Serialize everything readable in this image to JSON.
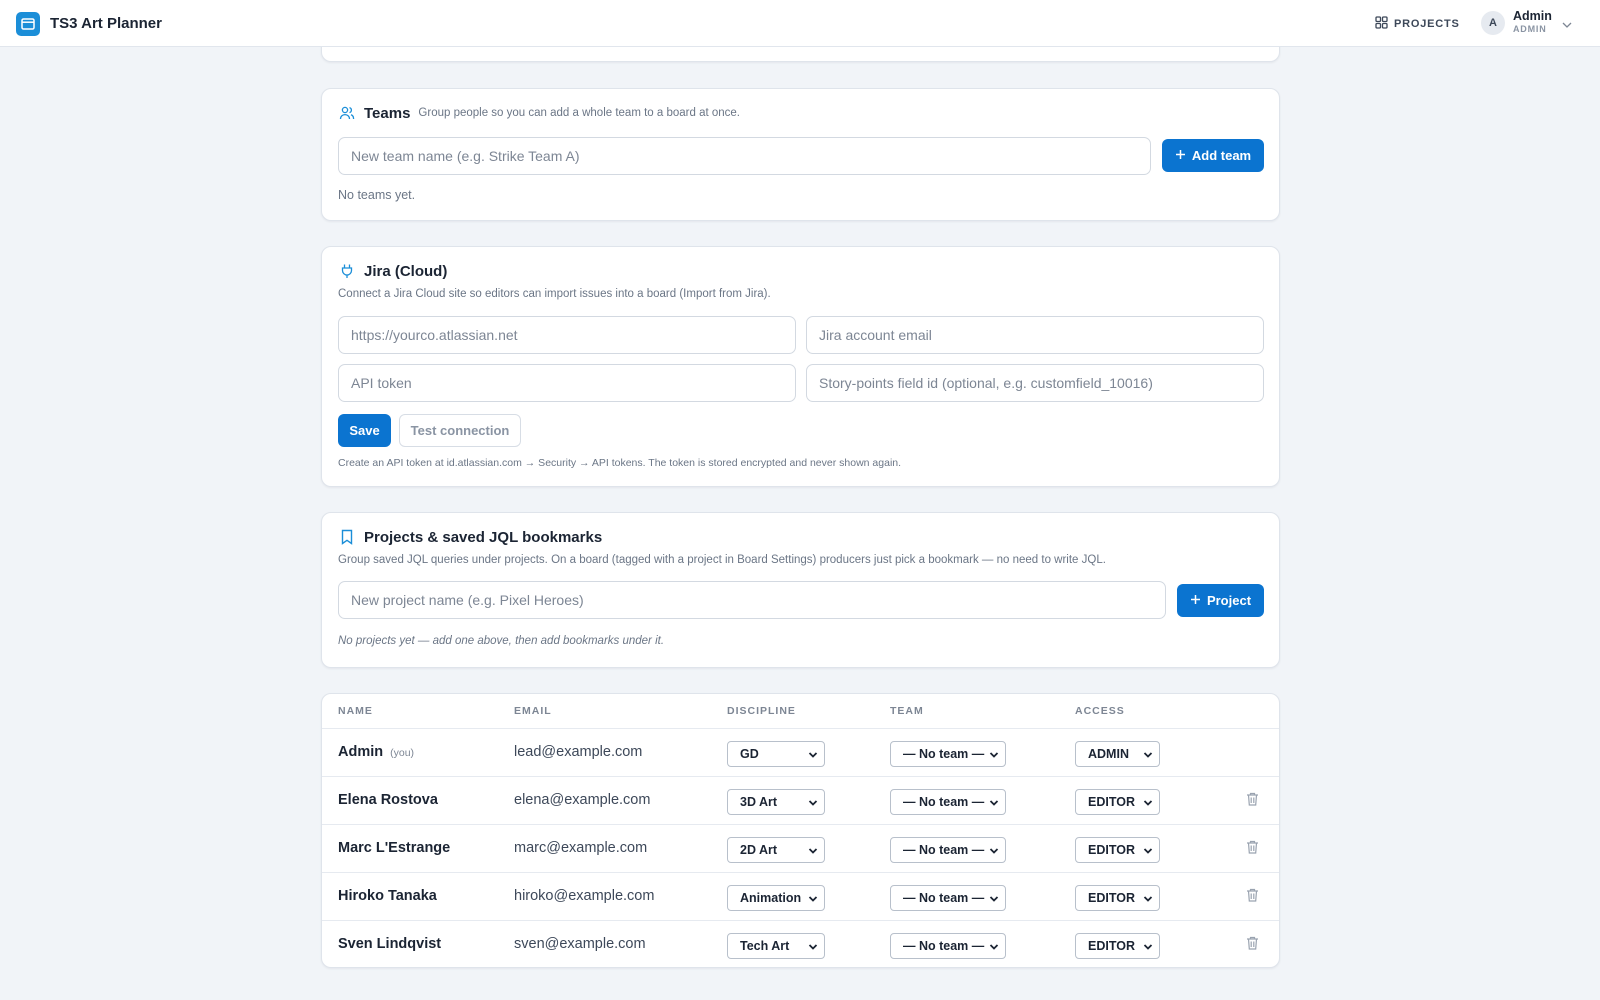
{
  "app": {
    "title": "TS3 Art Planner",
    "logo_icon": "app-window-icon"
  },
  "topbar": {
    "nav_projects_label": "PROJECTS",
    "user": {
      "initial": "A",
      "name": "Admin",
      "role": "ADMIN"
    }
  },
  "teams": {
    "title": "Teams",
    "subtitle": "Group people so you can add a whole team to a board at once.",
    "input_placeholder": "New team name (e.g. Strike Team A)",
    "add_label": "Add team",
    "empty_text": "No teams yet."
  },
  "jira": {
    "title": "Jira (Cloud)",
    "description": "Connect a Jira Cloud site so editors can import issues into a board (Import from Jira).",
    "site_placeholder": "https://yourco.atlassian.net",
    "email_placeholder": "Jira account email",
    "token_placeholder": "API token",
    "story_points_placeholder": "Story-points field id (optional, e.g. customfield_10016)",
    "save_label": "Save",
    "test_label": "Test connection",
    "hint": "Create an API token at id.atlassian.com → Security → API tokens. The token is stored encrypted and never shown again."
  },
  "projects": {
    "title": "Projects & saved JQL bookmarks",
    "description": "Group saved JQL queries under projects. On a board (tagged with a project in Board Settings) producers just pick a bookmark — no need to write JQL.",
    "input_placeholder": "New project name (e.g. Pixel Heroes)",
    "add_label": "Project",
    "empty_text": "No projects yet — add one above, then add bookmarks under it."
  },
  "users": {
    "columns": {
      "name": "NAME",
      "email": "EMAIL",
      "discipline": "DISCIPLINE",
      "team": "TEAM",
      "access": "ACCESS"
    },
    "you_tag": "(you)",
    "rows": [
      {
        "name": "Admin",
        "email": "lead@example.com",
        "discipline": "GD",
        "team": "— No team —",
        "access": "ADMIN"
      },
      {
        "name": "Elena Rostova",
        "email": "elena@example.com",
        "discipline": "3D Art",
        "team": "— No team —",
        "access": "EDITOR"
      },
      {
        "name": "Marc L'Estrange",
        "email": "marc@example.com",
        "discipline": "2D Art",
        "team": "— No team —",
        "access": "EDITOR"
      },
      {
        "name": "Hiroko Tanaka",
        "email": "hiroko@example.com",
        "discipline": "Animation",
        "team": "— No team —",
        "access": "EDITOR"
      },
      {
        "name": "Sven Lindqvist",
        "email": "sven@example.com",
        "discipline": "Tech Art",
        "team": "— No team —",
        "access": "EDITOR"
      }
    ]
  },
  "colors": {
    "accent": "#0b74d0",
    "background": "#f1f4f8",
    "card": "#ffffff",
    "muted_text": "#6b7686"
  }
}
